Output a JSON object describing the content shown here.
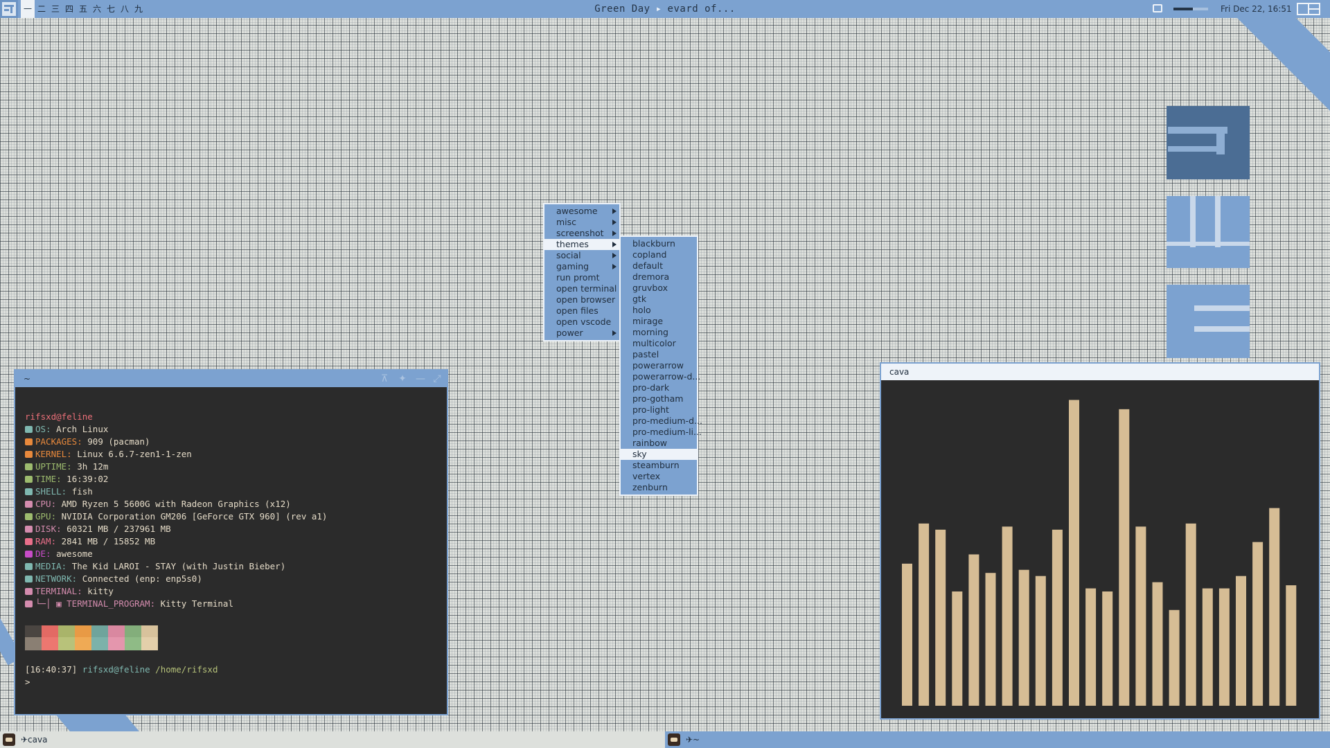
{
  "topbar": {
    "tags": [
      "一",
      "二",
      "三",
      "四",
      "五",
      "六",
      "七",
      "八",
      "九"
    ],
    "active_tag": 0,
    "now_playing": {
      "artist": "Green Day",
      "title": "evard of..."
    },
    "volume": 0.55,
    "clock": "Fri Dec 22, 16:51"
  },
  "main_menu": {
    "items": [
      {
        "label": "awesome",
        "submenu": true
      },
      {
        "label": "misc",
        "submenu": true
      },
      {
        "label": "screenshot",
        "submenu": true
      },
      {
        "label": "themes",
        "submenu": true,
        "selected": true
      },
      {
        "label": "social",
        "submenu": true
      },
      {
        "label": "gaming",
        "submenu": true
      },
      {
        "label": "run promt",
        "submenu": false
      },
      {
        "label": "open terminal",
        "submenu": false
      },
      {
        "label": "open browser",
        "submenu": false
      },
      {
        "label": "open files",
        "submenu": false
      },
      {
        "label": "open vscode",
        "submenu": false
      },
      {
        "label": "power",
        "submenu": true
      }
    ]
  },
  "themes_menu": {
    "items": [
      "blackburn",
      "copland",
      "default",
      "dremora",
      "gruvbox",
      "gtk",
      "holo",
      "mirage",
      "morning",
      "multicolor",
      "pastel",
      "powerarrow",
      "powerarrow-d...",
      "pro-dark",
      "pro-gotham",
      "pro-light",
      "pro-medium-d...",
      "pro-medium-li...",
      "rainbow",
      "sky",
      "steamburn",
      "vertex",
      "zenburn"
    ],
    "selected": "sky"
  },
  "terminal": {
    "title": "~",
    "user_host": "rifsxd@feline",
    "info": [
      {
        "key": "OS:",
        "value": "Arch Linux",
        "color": "#7fb8b0"
      },
      {
        "key": "PACKAGES:",
        "value": "909 (pacman)",
        "color": "#e8893c"
      },
      {
        "key": "KERNEL:",
        "value": "Linux 6.6.7-zen1-1-zen",
        "color": "#e8893c"
      },
      {
        "key": "UPTIME:",
        "value": "3h 12m",
        "color": "#9dbb6e"
      },
      {
        "key": "TIME:",
        "value": "16:39:02",
        "color": "#9dbb6e"
      },
      {
        "key": "SHELL:",
        "value": "fish",
        "color": "#7fb8b0"
      },
      {
        "key": "CPU:",
        "value": "AMD Ryzen 5 5600G with Radeon Graphics (x12)",
        "color": "#d48cae"
      },
      {
        "key": "GPU:",
        "value": "NVIDIA Corporation GM206 [GeForce GTX 960] (rev a1)",
        "color": "#9dbb6e"
      },
      {
        "key": "DISK:",
        "value": "60321 MB / 237961 MB",
        "color": "#d48cae"
      },
      {
        "key": "RAM:",
        "value": "2841 MB / 15852 MB",
        "color": "#ea6f8a"
      },
      {
        "key": "DE:",
        "value": "awesome",
        "color": "#c84cc8"
      },
      {
        "key": "MEDIA:",
        "value": "The Kid LAROI - STAY (with Justin Bieber)",
        "color": "#7fb8b0"
      },
      {
        "key": "NETWORK:",
        "value": "Connected (enp: enp5s0)",
        "color": "#7fb8b0"
      },
      {
        "key": "TERMINAL:",
        "value": "kitty",
        "color": "#d48cae"
      },
      {
        "key": "└─│ ▣ TERMINAL_PROGRAM:",
        "value": "Kitty Terminal",
        "color": "#d48cae"
      }
    ],
    "palette": [
      [
        "#4a4541",
        "#8a7f73"
      ],
      [
        "#e36a64",
        "#ec7770"
      ],
      [
        "#a9b46a",
        "#b8c27a"
      ],
      [
        "#e89a45",
        "#efaa55"
      ],
      [
        "#6fa49c",
        "#7cb2aa"
      ],
      [
        "#d988a0",
        "#e496ad"
      ],
      [
        "#83ae7b",
        "#8fbb86"
      ],
      [
        "#d8c29c",
        "#e3cfaa"
      ]
    ],
    "prompt": {
      "time": "[16:40:37]",
      "user": "rifsxd@feline",
      "path": "/home/rifsxd",
      "symbol": ">"
    }
  },
  "cava": {
    "title": "cava",
    "bar_color": "#d6bd95",
    "levels": [
      0.46,
      0.59,
      0.57,
      0.37,
      0.49,
      0.43,
      0.58,
      0.44,
      0.42,
      0.57,
      0.99,
      0.38,
      0.37,
      0.96,
      0.58,
      0.4,
      0.31,
      0.59,
      0.38,
      0.38,
      0.42,
      0.53,
      0.64,
      0.39
    ]
  },
  "taskbar": [
    {
      "label": "✈cava"
    },
    {
      "label": "✈~"
    }
  ]
}
